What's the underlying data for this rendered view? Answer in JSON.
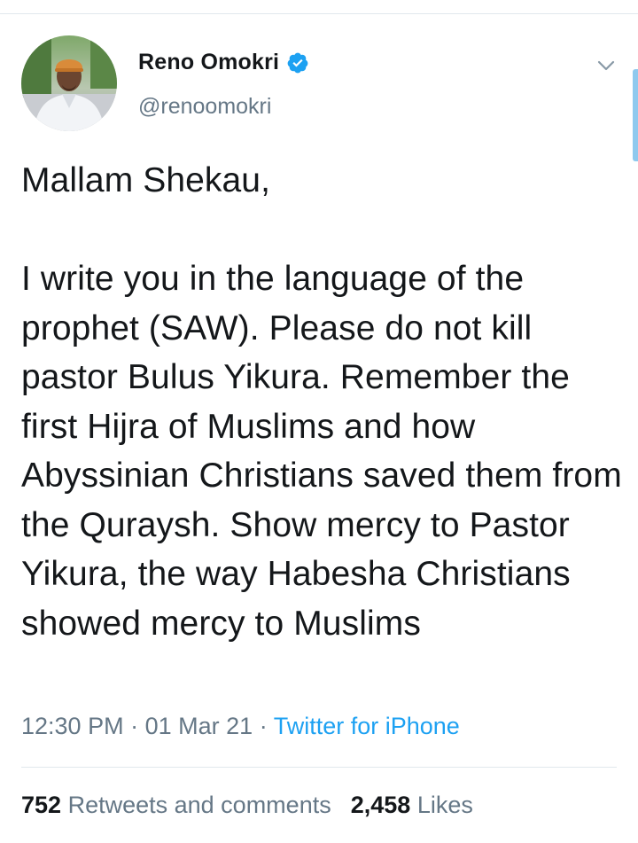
{
  "tweet": {
    "author": {
      "display_name": "Reno Omokri",
      "handle": "@renoomokri",
      "verified": true
    },
    "text": "Mallam Shekau,\n\nI write you in the language of the prophet (SAW). Please do not kill pastor Bulus Yikura. Remember the first Hijra of Muslims and how Abyssinian Christians saved them from the Quraysh. Show mercy to Pastor Yikura, the way Habesha Christians showed mercy to Muslims",
    "time": "12:30 PM",
    "separator": "·",
    "date": "01 Mar 21",
    "source": "Twitter for iPhone",
    "stats": {
      "retweets_count": "752",
      "retweets_label": "Retweets and comments",
      "likes_count": "2,458",
      "likes_label": "Likes"
    }
  },
  "icons": {
    "verified": "verified-badge-icon",
    "menu": "chevron-down-icon"
  },
  "colors": {
    "text": "#14171a",
    "secondary": "#657786",
    "link": "#1da1f2",
    "verified": "#1da1f2",
    "divider": "#e1e8ed"
  }
}
